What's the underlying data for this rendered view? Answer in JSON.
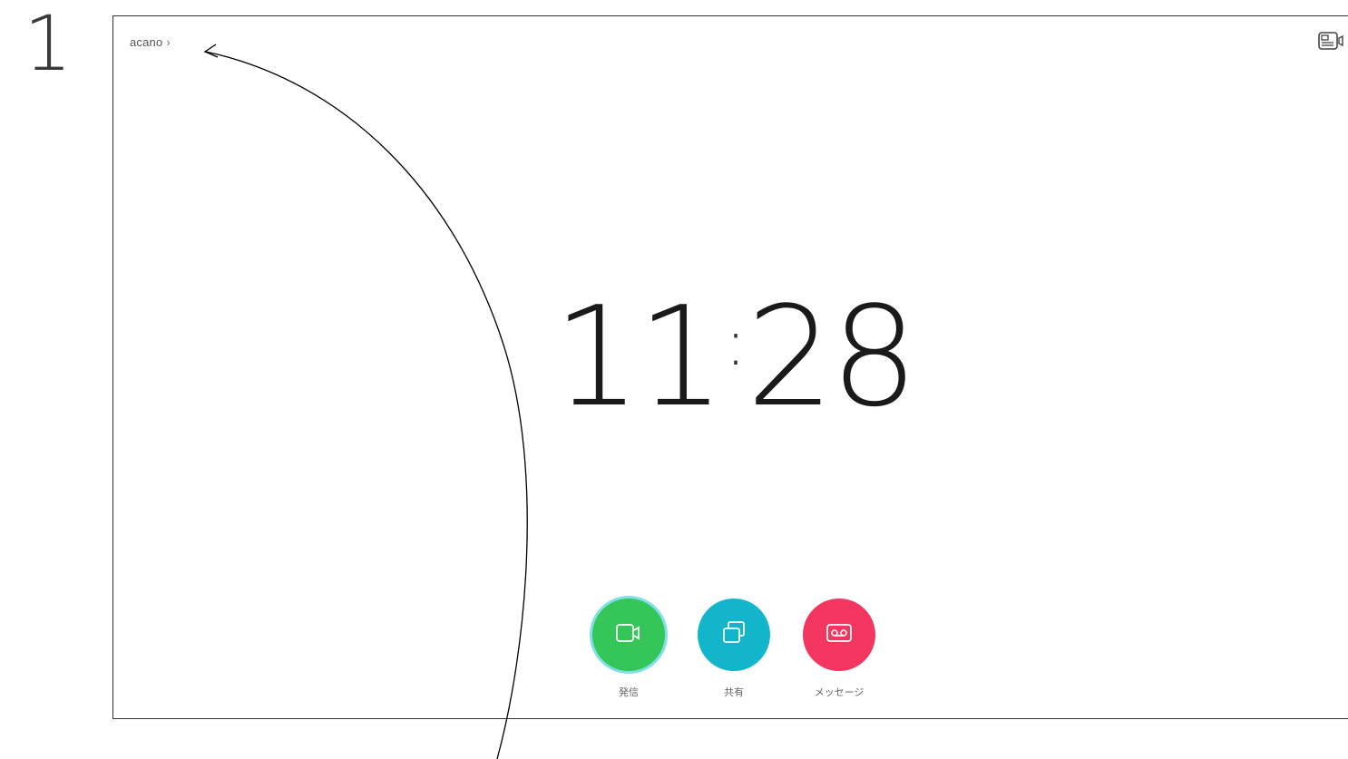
{
  "step": {
    "number": "1"
  },
  "header": {
    "breadcrumb_label": "acano",
    "breadcrumb_chevron": "›",
    "selfview_icon": "selfview-camera-icon"
  },
  "clock": {
    "hours": "11",
    "colon": ":",
    "minutes": "28"
  },
  "actions": [
    {
      "label": "発信",
      "icon": "video-camera-icon",
      "color": "#34c658"
    },
    {
      "label": "共有",
      "icon": "share-screen-icon",
      "color": "#12b5c9"
    },
    {
      "label": "メッセージ",
      "icon": "voicemail-icon",
      "color": "#f2365f"
    }
  ],
  "colors": {
    "call": "#34c658",
    "share": "#12b5c9",
    "messages": "#f2365f",
    "frame": "#333333"
  }
}
